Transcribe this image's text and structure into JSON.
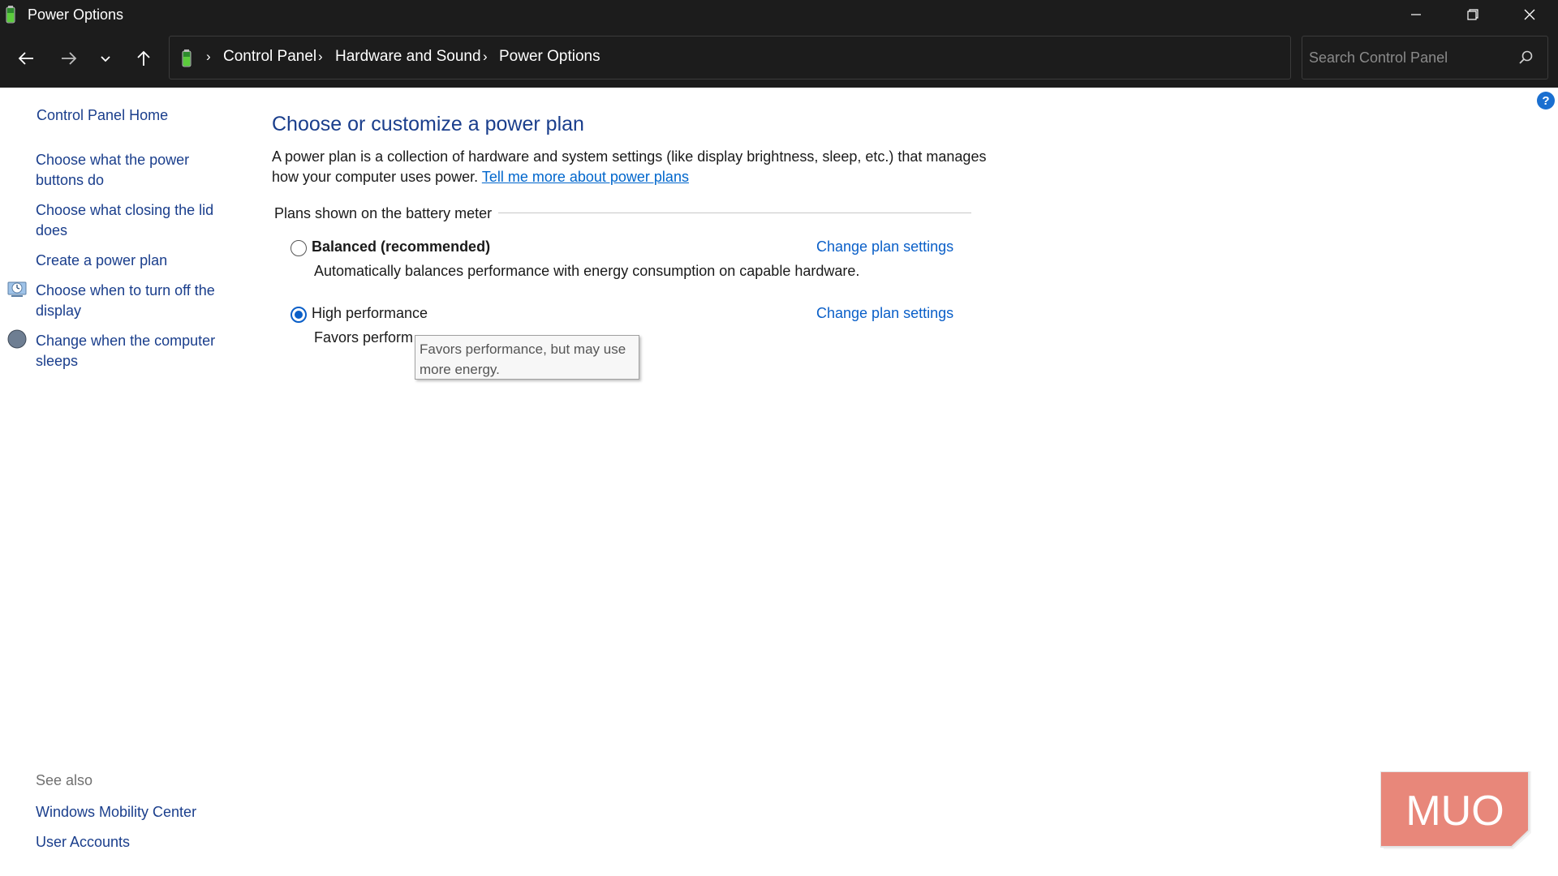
{
  "window": {
    "title": "Power Options",
    "minimize_icon": "minimize-icon",
    "maximize_icon": "restore-icon",
    "close_icon": "close-icon"
  },
  "nav": {
    "breadcrumb": [
      "Control Panel",
      "Hardware and Sound",
      "Power Options"
    ],
    "search_placeholder": "Search Control Panel"
  },
  "sidebar": {
    "home": "Control Panel Home",
    "links": [
      "Choose what the power buttons do",
      "Choose what closing the lid does",
      "Create a power plan",
      "Choose when to turn off the display",
      "Change when the computer sleeps"
    ],
    "see_also_label": "See also",
    "see_also": [
      "Windows Mobility Center",
      "User Accounts"
    ]
  },
  "main": {
    "title": "Choose or customize a power plan",
    "description": "A power plan is a collection of hardware and system settings (like display brightness, sleep, etc.) that manages how your computer uses power.",
    "description_link": "Tell me more about power plans",
    "group_label": "Plans shown on the battery meter",
    "plans": [
      {
        "name": "Balanced (recommended)",
        "description": "Automatically balances performance with energy consumption on capable hardware.",
        "link": "Change plan settings",
        "selected": false
      },
      {
        "name": "High performance",
        "description": "Favors perform",
        "link": "Change plan settings",
        "selected": true
      }
    ],
    "tooltip": "Favors performance, but may use more energy."
  },
  "watermark": {
    "text": "MUO",
    "colors": {
      "box": "#e8877a",
      "text": "#ffffff"
    }
  },
  "colors": {
    "titlebar": "#1c1c1c",
    "link": "#1a3e8c",
    "accent": "#0a5fc8"
  }
}
